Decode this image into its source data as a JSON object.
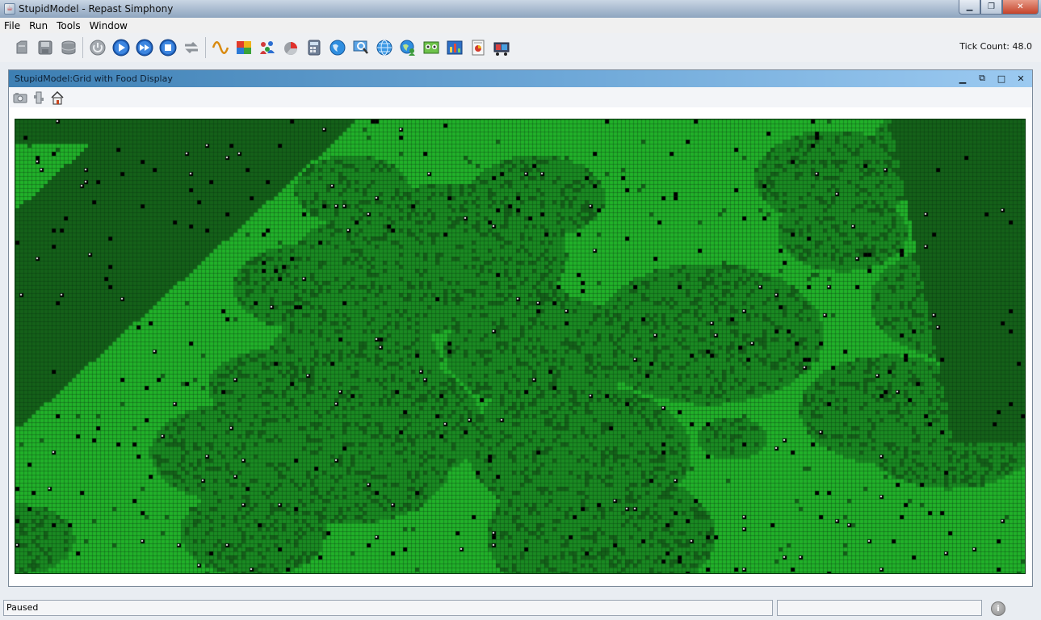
{
  "window": {
    "title": "StupidModel - Repast Simphony",
    "app_icon": "java-cup-icon",
    "controls": {
      "minimize_icon": "minimize-icon",
      "maximize_icon": "maximize-icon",
      "close_icon": "close-icon"
    }
  },
  "menu": {
    "items": [
      {
        "label": "File"
      },
      {
        "label": "Run"
      },
      {
        "label": "Tools"
      },
      {
        "label": "Window"
      }
    ]
  },
  "toolbar": {
    "tick_count": "Tick Count: 48.0",
    "groups": [
      [
        "load-model-icon",
        "save-model-icon",
        "database-icon"
      ],
      [
        "initialize-icon",
        "start-run-icon",
        "step-icon",
        "stop-icon",
        "reset-icon"
      ],
      [
        "wave-icon",
        "color-blocks-icon",
        "agents-icon",
        "pie-chart-icon",
        "calculator-icon",
        "globe-icon",
        "search-monitor-icon",
        "network-globe-icon",
        "globe-user-icon",
        "image-export-icon",
        "chart-export-icon",
        "report-icon",
        "movie-icon"
      ]
    ]
  },
  "display": {
    "title": "StupidModel:Grid with Food Display",
    "toolbar_icons": [
      "snapshot-icon",
      "settings-icon",
      "home-icon"
    ],
    "grid_colors": {
      "background": "#1a7a22",
      "gridline": "#0a2e0e",
      "bright_food": "#21b12a",
      "medium_food": "#1a8a22",
      "dark_food": "#146119",
      "agent": "#000000",
      "agent_highlight": "#ffffff"
    }
  },
  "status": {
    "message": "Paused",
    "secondary": "",
    "info_icon": "info-icon"
  }
}
